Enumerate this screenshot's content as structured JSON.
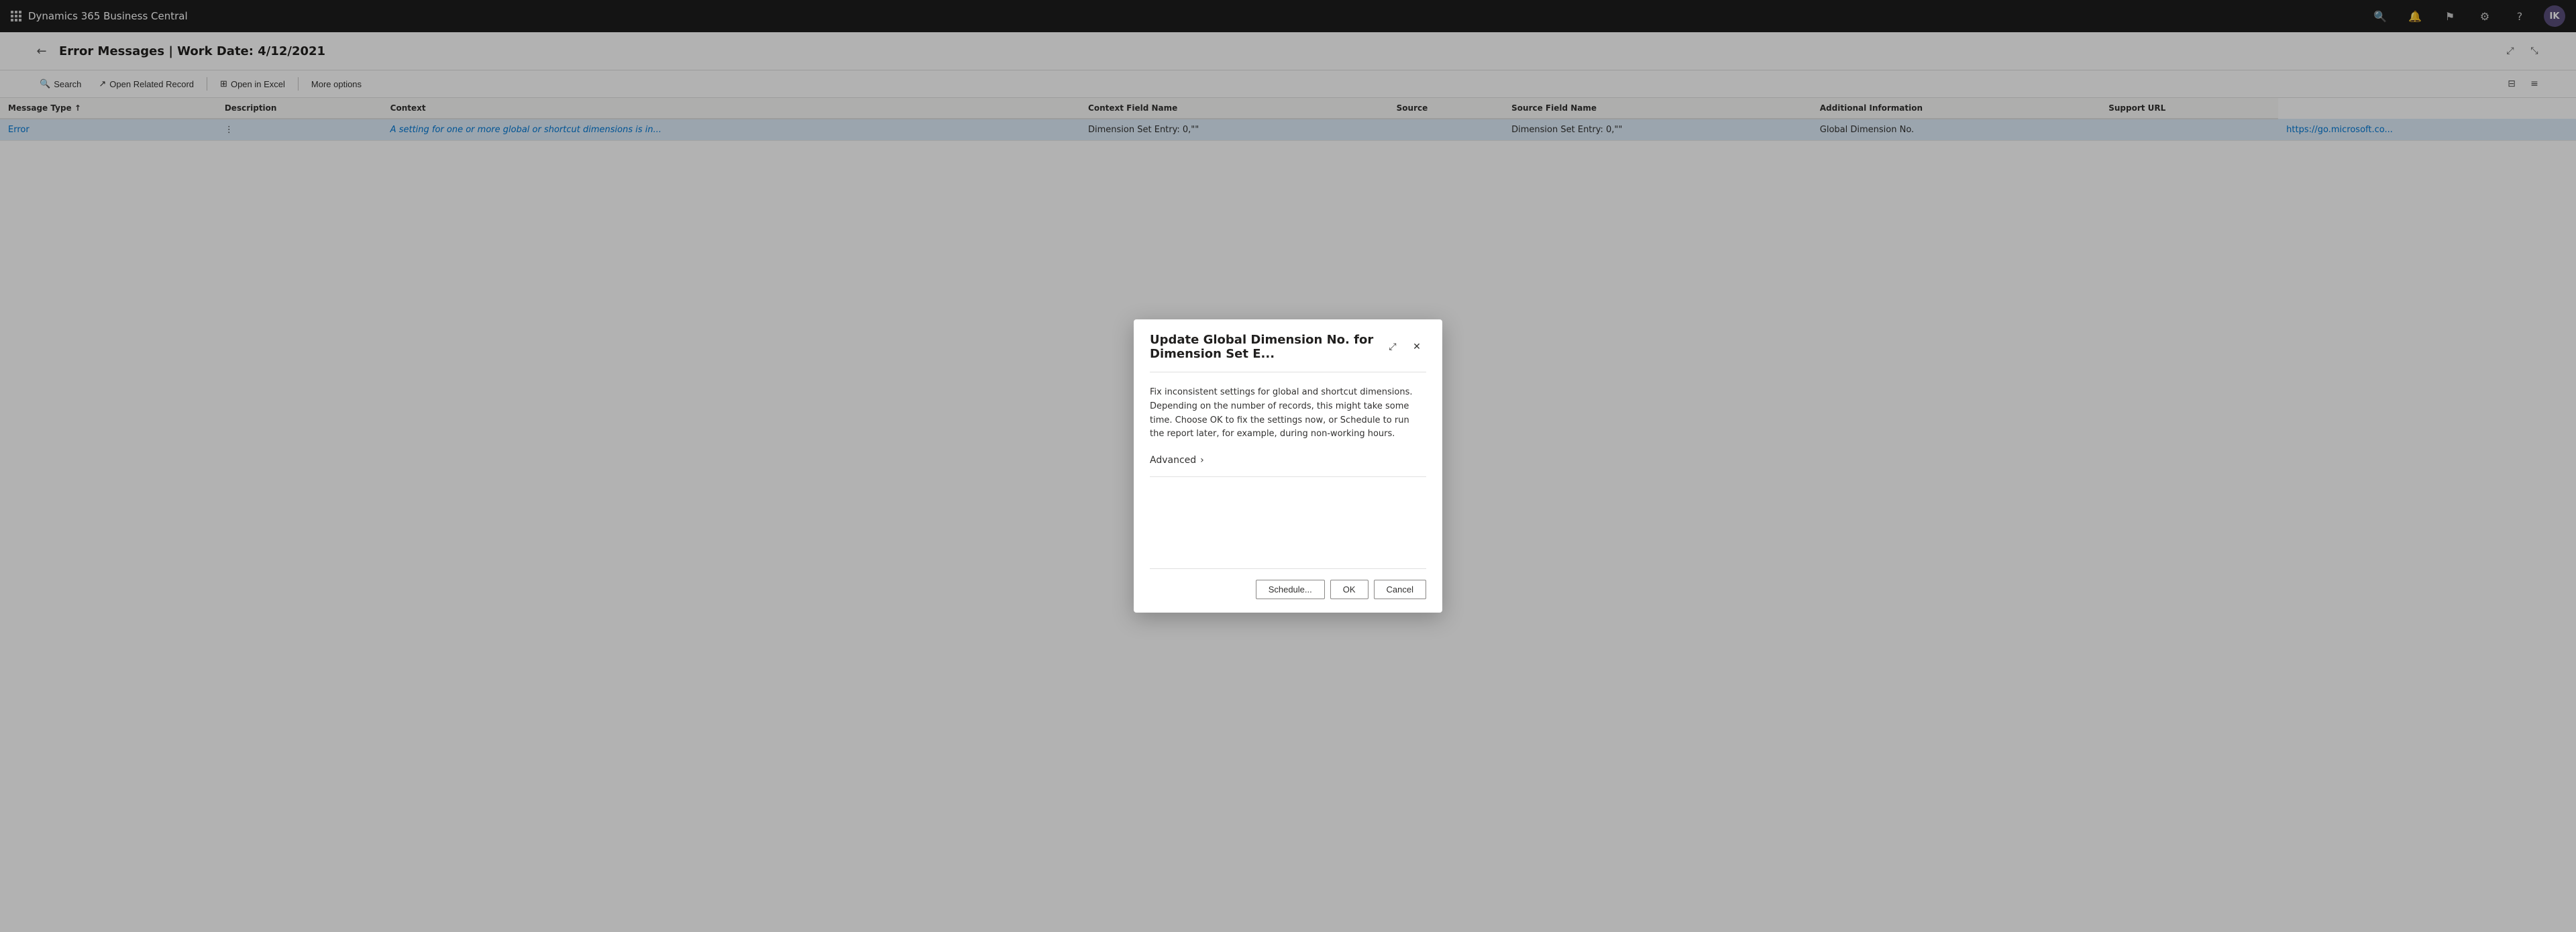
{
  "app": {
    "title": "Dynamics 365 Business Central"
  },
  "topbar": {
    "title": "Dynamics 365 Business Central",
    "icons": {
      "search": "🔍",
      "notifications": "🔔",
      "bookmark": "🚩",
      "settings": "⚙",
      "help": "?",
      "avatar_initials": "IK"
    }
  },
  "page": {
    "title": "Error Messages | Work Date: 4/12/2021",
    "back_label": "←"
  },
  "toolbar": {
    "search_label": "Search",
    "open_related_label": "Open Related Record",
    "open_excel_label": "Open in Excel",
    "more_options_label": "More options"
  },
  "table": {
    "columns": [
      "Message Type ↑",
      "Description",
      "Context",
      "Context Field Name",
      "Source",
      "Source Field Name",
      "Additional Information",
      "Support URL"
    ],
    "rows": [
      {
        "message_type": "Error",
        "description": "A setting for one or more global or shortcut dimensions is in...",
        "context": "Dimension Set Entry: 0,\"\"",
        "context_field_name": "",
        "source": "Dimension Set Entry: 0,\"\"",
        "source_field_name": "Global Dimension No.",
        "additional_information": "",
        "support_url": "https://go.microsoft.co..."
      }
    ]
  },
  "modal": {
    "title": "Update Global Dimension No. for Dimension Set E...",
    "body": "Fix inconsistent settings for global and shortcut dimensions. Depending on the number of records, this might take some time. Choose OK to fix the settings now, or Schedule to run the report later, for example, during non-working hours.",
    "advanced_label": "Advanced",
    "chevron": "›",
    "buttons": {
      "schedule": "Schedule...",
      "ok": "OK",
      "cancel": "Cancel"
    }
  }
}
